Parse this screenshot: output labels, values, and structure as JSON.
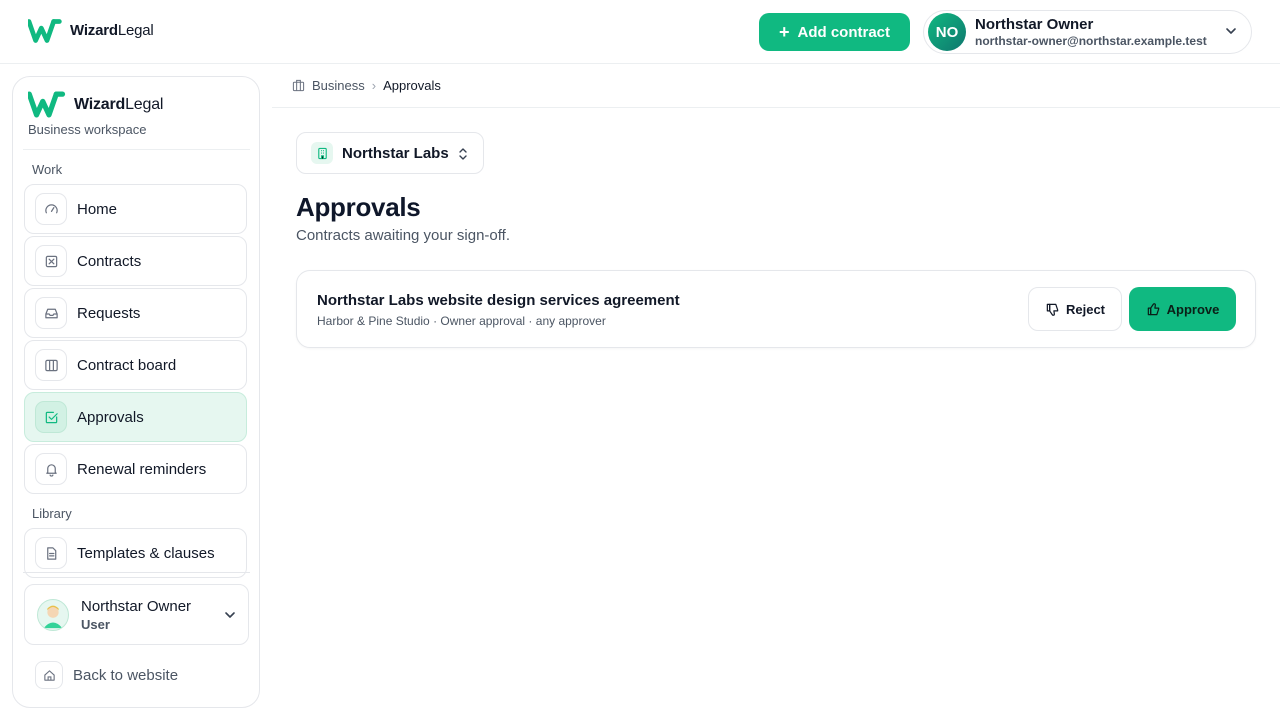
{
  "brand": {
    "name_bold": "Wizard",
    "name_light": "Legal",
    "color": "#10b981"
  },
  "header": {
    "add_contract_label": "Add contract",
    "user": {
      "initials": "NO",
      "name": "Northstar Owner",
      "email": "northstar-owner@northstar.example.test"
    }
  },
  "sidebar": {
    "workspace_label": "Business workspace",
    "sections": {
      "work": "Work",
      "library": "Library"
    },
    "items": [
      {
        "label": "Home",
        "icon": "gauge-icon"
      },
      {
        "label": "Contracts",
        "icon": "contract-icon"
      },
      {
        "label": "Requests",
        "icon": "inbox-icon"
      },
      {
        "label": "Contract board",
        "icon": "columns-icon"
      },
      {
        "label": "Approvals",
        "icon": "check-square-icon",
        "active": true
      },
      {
        "label": "Renewal reminders",
        "icon": "bell-icon"
      },
      {
        "label": "Templates & clauses",
        "icon": "document-icon"
      }
    ],
    "profile": {
      "name": "Northstar Owner",
      "role": "User"
    },
    "back_label": "Back to website"
  },
  "breadcrumb": {
    "parent": "Business",
    "current": "Approvals"
  },
  "org_selector": {
    "value": "Northstar Labs"
  },
  "page": {
    "title": "Approvals",
    "subtitle": "Contracts awaiting your sign-off."
  },
  "approvals": [
    {
      "title": "Northstar Labs website design services agreement",
      "subtitle": "Harbor & Pine Studio · Owner approval · any approver",
      "reject_label": "Reject",
      "approve_label": "Approve"
    }
  ],
  "colors": {
    "accent": "#10b981",
    "active_bg": "#e6f7f0"
  }
}
